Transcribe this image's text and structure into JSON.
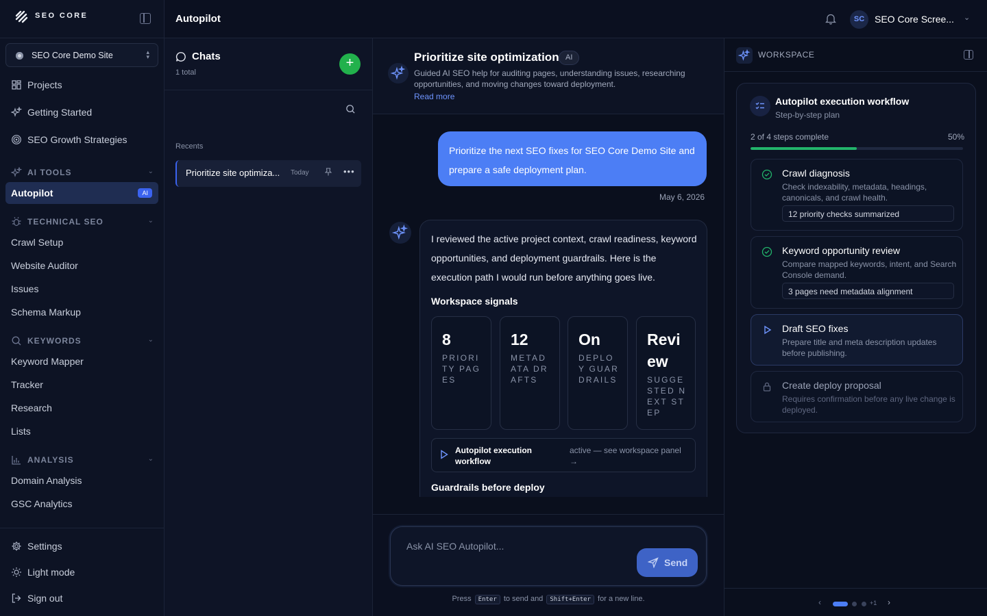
{
  "brand": {
    "name": "SEO CORE"
  },
  "sidebar": {
    "site": "SEO Core Demo Site",
    "top_items": [
      {
        "label": "Projects",
        "icon": "grid-icon"
      },
      {
        "label": "Getting Started",
        "icon": "sparkles-icon"
      },
      {
        "label": "SEO Growth Strategies",
        "icon": "target-icon"
      }
    ],
    "sections": [
      {
        "label": "AI TOOLS",
        "icon": "sparkles-icon"
      },
      {
        "label": "TECHNICAL SEO",
        "icon": "bug-icon",
        "items": [
          "Crawl Setup",
          "Website Auditor",
          "Issues",
          "Schema Markup"
        ]
      },
      {
        "label": "KEYWORDS",
        "icon": "search-icon",
        "items": [
          "Keyword Mapper",
          "Tracker",
          "Research",
          "Lists"
        ]
      },
      {
        "label": "ANALYSIS",
        "icon": "bar-chart-icon",
        "items": [
          "Domain Analysis",
          "GSC Analytics"
        ]
      }
    ],
    "active_item": {
      "label": "Autopilot",
      "badge": "AI"
    },
    "footer": [
      {
        "label": "Settings",
        "icon": "gear-icon"
      },
      {
        "label": "Light mode",
        "icon": "sun-icon"
      },
      {
        "label": "Sign out",
        "icon": "sign-out-icon"
      }
    ]
  },
  "header": {
    "title": "Autopilot",
    "user_initials": "SC",
    "user_name": "SEO Core Scree..."
  },
  "chats": {
    "title": "Chats",
    "count": "1 total",
    "new_label": "+",
    "recents_label": "Recents",
    "items": [
      {
        "title": "Prioritize site optimiza...",
        "date": "Today"
      }
    ]
  },
  "conversation": {
    "title": "Prioritize site optimization",
    "badge": "AI",
    "description": "Guided AI SEO help for auditing pages, understanding issues, researching opportunities, and moving changes toward deployment.",
    "read_more": "Read more",
    "user_message": "Prioritize the next SEO fixes for SEO Core Demo Site and prepare a safe deployment plan.",
    "user_message_date": "May 6, 2026",
    "assistant_text": "I reviewed the active project context, crawl readiness, keyword opportunities, and deployment guardrails. Here is the execution path I would run before anything goes live.",
    "signals_title": "Workspace signals",
    "signals": [
      {
        "value": "8",
        "label": "PRIORITY PAGES"
      },
      {
        "value": "12",
        "label": "METADATA DRAFTS"
      },
      {
        "value": "On",
        "label": "DEPLOY GUARDRAILS"
      },
      {
        "value": "Review",
        "label": "SUGGESTED NEXT STEP"
      }
    ],
    "workflow_card": {
      "name": "Autopilot execution workflow",
      "status": "active — see workspace panel →"
    },
    "guardrails_title": "Guardrails before deploy",
    "composer_placeholder": "Ask AI SEO Autopilot...",
    "send_label": "Send",
    "hint": {
      "press": "Press",
      "key1": "Enter",
      "mid": "to send and",
      "key2": "Shift+Enter",
      "end": "for a new line."
    }
  },
  "workspace": {
    "title": "WORKSPACE",
    "plan_title": "Autopilot execution workflow",
    "plan_subtitle": "Step-by-step plan",
    "progress_text": "2 of 4 steps complete",
    "progress_pct": "50%",
    "progress_value": 0.5,
    "steps": [
      {
        "title": "Crawl diagnosis",
        "desc": "Check indexability, metadata, headings, canonicals, and crawl health.",
        "chip": "12 priority checks summarized",
        "state": "done"
      },
      {
        "title": "Keyword opportunity review",
        "desc": "Compare mapped keywords, intent, and Search Console demand.",
        "chip": "3 pages need metadata alignment",
        "state": "done"
      },
      {
        "title": "Draft SEO fixes",
        "desc": "Prepare title and meta description updates before publishing.",
        "state": "current"
      },
      {
        "title": "Create deploy proposal",
        "desc": "Requires confirmation before any live change is deployed.",
        "state": "locked"
      }
    ],
    "pager": {
      "prev": "‹",
      "extra": "+1",
      "next": "›"
    }
  },
  "colors": {
    "accent": "#4c7ef5",
    "success": "#22b46b",
    "new_chat": "#22b14c",
    "background": "#0b1020"
  }
}
